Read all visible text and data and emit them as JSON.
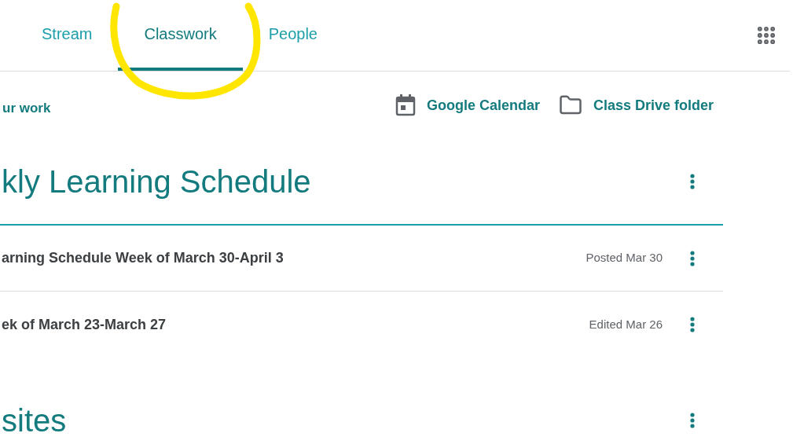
{
  "tabs": [
    {
      "label": "Stream",
      "selected": false
    },
    {
      "label": "Classwork",
      "selected": true
    },
    {
      "label": "People",
      "selected": false
    }
  ],
  "toolbar": {
    "your_work": "ur work",
    "links": [
      {
        "kind": "calendar",
        "label": "Google Calendar"
      },
      {
        "kind": "folder",
        "label": "Class Drive folder"
      }
    ]
  },
  "topics": [
    {
      "title": "kly Learning Schedule",
      "items": [
        {
          "title": "arning Schedule Week of March 30-April 3",
          "meta": "Posted Mar 30"
        },
        {
          "title": "ek of March 23-March 27",
          "meta": "Edited Mar 26"
        }
      ]
    },
    {
      "title": "sites"
    }
  ],
  "annotation": {
    "kind": "circle"
  }
}
